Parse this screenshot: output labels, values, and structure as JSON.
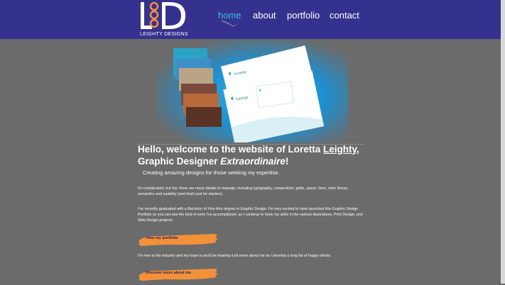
{
  "header": {
    "logo_text": "LEIGHTY DESIGNS",
    "nav": [
      {
        "label": "home",
        "active": true
      },
      {
        "label": "about",
        "active": false
      },
      {
        "label": "portfolio",
        "active": false
      },
      {
        "label": "contact",
        "active": false
      }
    ]
  },
  "hero": {
    "brand_name": "Trinergy"
  },
  "main": {
    "heading": {
      "part1": "Hello, welcome to the website of Loretta ",
      "name": "Leighty",
      "part2": ", Graphic Designer ",
      "emphasis": "Extraordinaire",
      "part3": "!"
    },
    "subtitle": "Creating amazing designs for those seeking my expertise.",
    "paragraph1": "It's complicated, but fun; there are many details to manage, including typography, composition, grids, space, form, color theory, semantics and usability (and that's just for starters).",
    "paragraph2": "I've recently graduated with a Bachelor of Fine Arts degree in Graphic Design. I'm very excited to have launched this Graphic Design Portfolio so you can see the kind of work I've accomplished, as I continue to hone my skills in the various illustrations, Print Design, and Web Design projects.",
    "portfolio_button": "View my portfolio",
    "paragraph3": "I'm new to the industry and my hope is you'll be hearing a lot more about me as I develop a long list of happy clients.",
    "about_button": "Discover more about me"
  },
  "colors": {
    "header_bg": "#35328f",
    "page_bg": "#6b6b6b",
    "nav_active": "#34c3d8",
    "brush_orange": "#f3913a"
  }
}
